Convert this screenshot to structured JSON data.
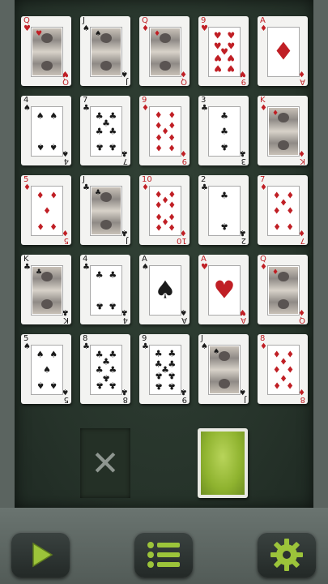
{
  "colors": {
    "red": "#c01f25",
    "black": "#1b1b1b",
    "felt": "#26332a",
    "accent": "#9cc43a"
  },
  "tableau": [
    [
      {
        "rank": "Q",
        "suit": "♥",
        "color": "red",
        "type": "court"
      },
      {
        "rank": "J",
        "suit": "♠",
        "color": "black",
        "type": "court"
      },
      {
        "rank": "Q",
        "suit": "♦",
        "color": "red",
        "type": "court"
      },
      {
        "rank": "9",
        "suit": "♥",
        "color": "red",
        "type": "pips",
        "n": 9
      },
      {
        "rank": "A",
        "suit": "♦",
        "color": "red",
        "type": "ace"
      }
    ],
    [
      {
        "rank": "4",
        "suit": "♠",
        "color": "black",
        "type": "pips",
        "n": 4
      },
      {
        "rank": "7",
        "suit": "♣",
        "color": "black",
        "type": "pips",
        "n": 7
      },
      {
        "rank": "9",
        "suit": "♦",
        "color": "red",
        "type": "pips",
        "n": 9
      },
      {
        "rank": "3",
        "suit": "♣",
        "color": "black",
        "type": "pips",
        "n": 3
      },
      {
        "rank": "K",
        "suit": "♦",
        "color": "red",
        "type": "court"
      }
    ],
    [
      {
        "rank": "5",
        "suit": "♦",
        "color": "red",
        "type": "pips",
        "n": 5
      },
      {
        "rank": "J",
        "suit": "♣",
        "color": "black",
        "type": "court"
      },
      {
        "rank": "10",
        "suit": "♦",
        "color": "red",
        "type": "pips",
        "n": 10
      },
      {
        "rank": "2",
        "suit": "♣",
        "color": "black",
        "type": "pips",
        "n": 2
      },
      {
        "rank": "7",
        "suit": "♦",
        "color": "red",
        "type": "pips",
        "n": 7
      }
    ],
    [
      {
        "rank": "K",
        "suit": "♣",
        "color": "black",
        "type": "court"
      },
      {
        "rank": "4",
        "suit": "♣",
        "color": "black",
        "type": "pips",
        "n": 4
      },
      {
        "rank": "A",
        "suit": "♠",
        "color": "black",
        "type": "ace"
      },
      {
        "rank": "A",
        "suit": "♥",
        "color": "red",
        "type": "ace"
      },
      {
        "rank": "Q",
        "suit": "♦",
        "color": "red",
        "type": "court"
      }
    ],
    [
      {
        "rank": "5",
        "suit": "♠",
        "color": "black",
        "type": "pips",
        "n": 5
      },
      {
        "rank": "8",
        "suit": "♣",
        "color": "black",
        "type": "pips",
        "n": 8
      },
      {
        "rank": "9",
        "suit": "♣",
        "color": "black",
        "type": "pips",
        "n": 9
      },
      {
        "rank": "J",
        "suit": "♠",
        "color": "black",
        "type": "court"
      },
      {
        "rank": "8",
        "suit": "♦",
        "color": "red",
        "type": "pips",
        "n": 8
      }
    ]
  ],
  "discard": {
    "icon": "close-icon",
    "glyph": "✕"
  },
  "stock": {
    "icon": "card-back"
  },
  "toolbar": {
    "play": {
      "icon": "play-icon"
    },
    "menu": {
      "icon": "menu-icon"
    },
    "settings": {
      "icon": "gear-icon"
    }
  }
}
